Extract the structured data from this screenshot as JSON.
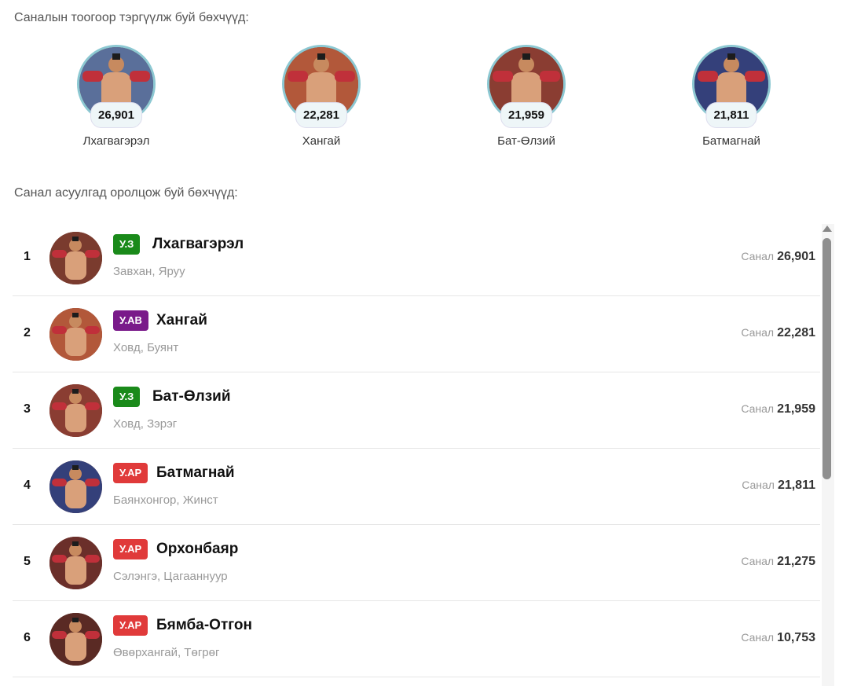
{
  "top_section": {
    "title": "Саналын тоогоор тэргүүлж буй бөхчүүд:",
    "wrestlers": [
      {
        "votes": "26,901",
        "name": "Лхагвагэрэл"
      },
      {
        "votes": "22,281",
        "name": "Хангай"
      },
      {
        "votes": "21,959",
        "name": "Бат-Өлзий"
      },
      {
        "votes": "21,811",
        "name": "Батмагнай"
      }
    ]
  },
  "list_section": {
    "title": "Санал асуулгад оролцож буй бөхчүүд:",
    "vote_label": "Санал",
    "rows": [
      {
        "rank": "1",
        "badge": "У.З",
        "badge_color": "#1a8a1a",
        "name": "Лхагвагэрэл",
        "region": "Завхан, Яруу",
        "votes": "26,901"
      },
      {
        "rank": "2",
        "badge": "У.АВ",
        "badge_color": "#7a1a8a",
        "name": "Хангай",
        "region": "Ховд, Буянт",
        "votes": "22,281"
      },
      {
        "rank": "3",
        "badge": "У.З",
        "badge_color": "#1a8a1a",
        "name": "Бат-Өлзий",
        "region": "Ховд, Зэрэг",
        "votes": "21,959"
      },
      {
        "rank": "4",
        "badge": "У.АР",
        "badge_color": "#e03a3a",
        "name": "Батмагнай",
        "region": "Баянхонгор, Жинст",
        "votes": "21,811"
      },
      {
        "rank": "5",
        "badge": "У.АР",
        "badge_color": "#e03a3a",
        "name": "Орхонбаяр",
        "region": "Сэлэнгэ, Цагааннуур",
        "votes": "21,275"
      },
      {
        "rank": "6",
        "badge": "У.АР",
        "badge_color": "#e03a3a",
        "name": "Бямба-Отгон",
        "region": "Өвөрхангай, Төгрөг",
        "votes": "10,753"
      }
    ]
  }
}
